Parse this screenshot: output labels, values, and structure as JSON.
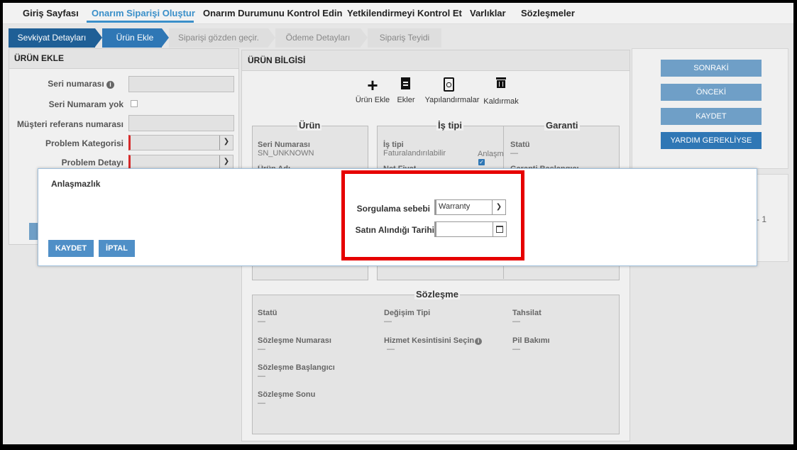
{
  "nav": {
    "items": [
      "Giriş Sayfası",
      "Onarım Siparişi Oluştur",
      "Onarım Durumunu Kontrol Edin",
      "Yetkilendirmeyi Kontrol Et",
      "Varlıklar",
      "Sözleşmeler"
    ],
    "active_index": 1
  },
  "steps": [
    "Sevkiyat Detayları",
    "Ürün Ekle",
    "Siparişi gözden geçir.",
    "Ödeme Detayları",
    "Sipariş Teyidi"
  ],
  "left_panel": {
    "title": "ÜRÜN EKLE",
    "serial_label": "Seri numarası",
    "no_serial_label": "Seri Numaram yok",
    "customer_ref_label": "Müşteri referans numarası",
    "problem_category_label": "Problem Kategorisi",
    "problem_detail_label": "Problem Detayı"
  },
  "product_info": {
    "title": "ÜRÜN BİLGİSİ",
    "toolbar": [
      {
        "icon": "plus-icon",
        "label": "Ürün Ekle"
      },
      {
        "icon": "document-icon",
        "label": "Ekler"
      },
      {
        "icon": "configure-icon",
        "label": "Yapılandırmalar"
      },
      {
        "icon": "trash-icon",
        "label": "Kaldırmak"
      }
    ],
    "product": {
      "title": "Ürün",
      "serial_label": "Seri Numarası",
      "serial_value": "SN_UNKNOWN",
      "product_name_partial": "Ürün Adı"
    },
    "job_type": {
      "title": "İş tipi",
      "label": "İş tipi",
      "value": "Faturalandırılabilir",
      "dispute_label": "Anlaşm",
      "net_price_partial": "Net Fiyat"
    },
    "warranty": {
      "title": "Garanti",
      "status_label": "Statü",
      "status_value": "—",
      "start_partial": "Garanti Başlangıcı"
    },
    "contract": {
      "title": "Sözleşme",
      "status_label": "Statü",
      "status_value": "—",
      "change_type_label": "Değişim Tipi",
      "change_type_value": "—",
      "collection_label": "Tahsilat",
      "collection_value": "—",
      "number_label": "Sözleşme Numarası",
      "number_value": "—",
      "service_cut_label": "Hizmet Kesintisini Seçin",
      "service_cut_value": "—",
      "battery_label": "Pil Bakımı",
      "battery_value": "—",
      "start_label": "Sözleşme Başlangıcı",
      "start_value": "—",
      "end_label": "Sözleşme Sonu",
      "end_value": "—"
    }
  },
  "right_panel": {
    "next": "SONRAKİ",
    "prev": "ÖNCEKİ",
    "save": "KAYDET",
    "help": "YARDIM GEREKLİYSE",
    "side_text": "- 1"
  },
  "dialog": {
    "title": "Anlaşmazlık",
    "reason_label": "Sorgulama sebebi",
    "reason_value": "Warranty",
    "purchase_date_label": "Satın Alındığı Tarihi",
    "purchase_date_value": "",
    "save_button": "KAYDET",
    "cancel_button": "İPTAL"
  },
  "colors": {
    "accent": "#2f77b5",
    "highlight": "#e60000",
    "required": "#d62a2a"
  }
}
